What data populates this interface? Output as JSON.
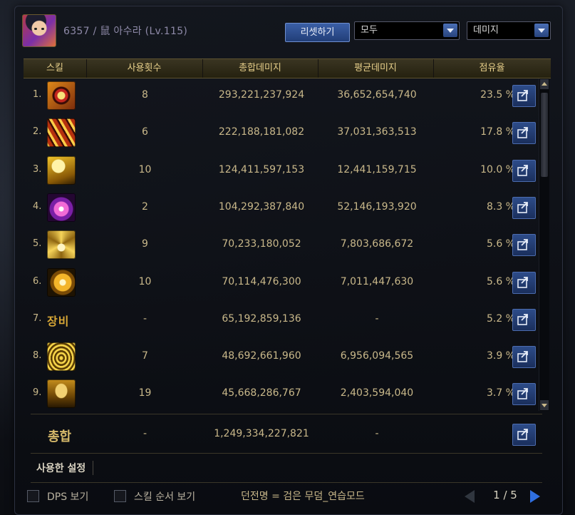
{
  "header": {
    "player_name": "6357 / 鼠 아수라 (Lv.115)",
    "reset_label": "리셋하기",
    "filter_value": "모두",
    "type_value": "데미지"
  },
  "columns": [
    "스킬",
    "사용횟수",
    "총합데미지",
    "평균데미지",
    "점유율"
  ],
  "rows": [
    {
      "rank": "1.",
      "icon": "eye-skill-icon",
      "count": "8",
      "total": "293,221,237,924",
      "avg": "36,652,654,740",
      "share": "23.5 %"
    },
    {
      "rank": "2.",
      "icon": "claw-slash-skill-icon",
      "count": "6",
      "total": "222,188,181,082",
      "avg": "37,031,363,513",
      "share": "17.8 %"
    },
    {
      "rank": "3.",
      "icon": "lightning-cloud-skill-icon",
      "count": "10",
      "total": "124,411,597,153",
      "avg": "12,441,159,715",
      "share": "10.0 %"
    },
    {
      "rank": "4.",
      "icon": "pink-sword-burst-skill-icon",
      "count": "2",
      "total": "104,292,387,840",
      "avg": "52,146,193,920",
      "share": "8.3 %"
    },
    {
      "rank": "5.",
      "icon": "crown-spikes-skill-icon",
      "count": "9",
      "total": "70,233,180,052",
      "avg": "7,803,686,672",
      "share": "5.6 %"
    },
    {
      "rank": "6.",
      "icon": "explosion-skill-icon",
      "count": "10",
      "total": "70,114,476,300",
      "avg": "7,011,447,630",
      "share": "5.6 %"
    },
    {
      "rank": "7.",
      "icon": "equipment-label",
      "label": "장비",
      "count": "-",
      "total": "65,192,859,136",
      "avg": "-",
      "share": "5.2 %"
    },
    {
      "rank": "8.",
      "icon": "whirlwind-skill-icon",
      "count": "7",
      "total": "48,692,661,960",
      "avg": "6,956,094,565",
      "share": "3.9 %"
    },
    {
      "rank": "9.",
      "icon": "warrior-stance-skill-icon",
      "count": "19",
      "total": "45,668,286,767",
      "avg": "2,403,594,040",
      "share": "3.7 %"
    }
  ],
  "total": {
    "label": "총합",
    "count": "-",
    "total": "1,249,334,227,821",
    "avg": "-"
  },
  "settings_label": "사용한 설정",
  "footer": {
    "dps_label": "DPS 보기",
    "skill_order_label": "스킬 순서 보기",
    "dungeon_text": "던전명 = 검은 무덤_연습모드",
    "page": "1 / 5"
  },
  "colors": {
    "accent_gold": "#e7cf8a",
    "button_blue": "#2d4c89",
    "pager_active": "#2f6fe0"
  }
}
